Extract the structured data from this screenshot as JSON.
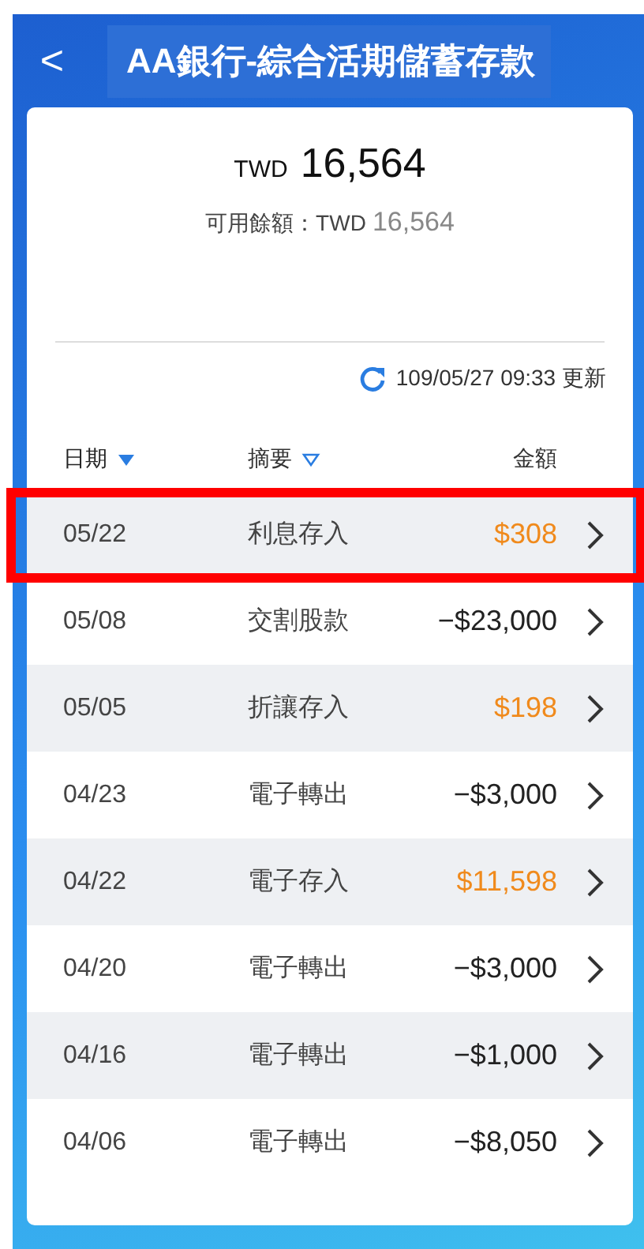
{
  "header": {
    "back": "<",
    "title": "AA銀行-綜合活期儲蓄存款"
  },
  "balance": {
    "currency": "TWD",
    "amount": "16,564",
    "available_label": "可用餘額：TWD",
    "available_amount": "16,564"
  },
  "update": {
    "text": "109/05/27 09:33 更新"
  },
  "columns": [
    {
      "label": "日期",
      "sortable": true,
      "sort_active": true
    },
    {
      "label": "摘要",
      "sortable": true,
      "sort_active": false
    },
    {
      "label": "金額",
      "sortable": false,
      "sort_active": false
    }
  ],
  "rows": [
    {
      "date": "05/22",
      "summary": "利息存入",
      "amount": "$308",
      "kind": "credit",
      "highlighted": true
    },
    {
      "date": "05/08",
      "summary": "交割股款",
      "amount": "−$23,000",
      "kind": "debit",
      "highlighted": false
    },
    {
      "date": "05/05",
      "summary": "折讓存入",
      "amount": "$198",
      "kind": "credit",
      "highlighted": false
    },
    {
      "date": "04/23",
      "summary": "電子轉出",
      "amount": "−$3,000",
      "kind": "debit",
      "highlighted": false
    },
    {
      "date": "04/22",
      "summary": "電子存入",
      "amount": "$11,598",
      "kind": "credit",
      "highlighted": false
    },
    {
      "date": "04/20",
      "summary": "電子轉出",
      "amount": "−$3,000",
      "kind": "debit",
      "highlighted": false
    },
    {
      "date": "04/16",
      "summary": "電子轉出",
      "amount": "−$1,000",
      "kind": "debit",
      "highlighted": false
    },
    {
      "date": "04/06",
      "summary": "電子轉出",
      "amount": "−$8,050",
      "kind": "debit",
      "highlighted": false
    }
  ]
}
